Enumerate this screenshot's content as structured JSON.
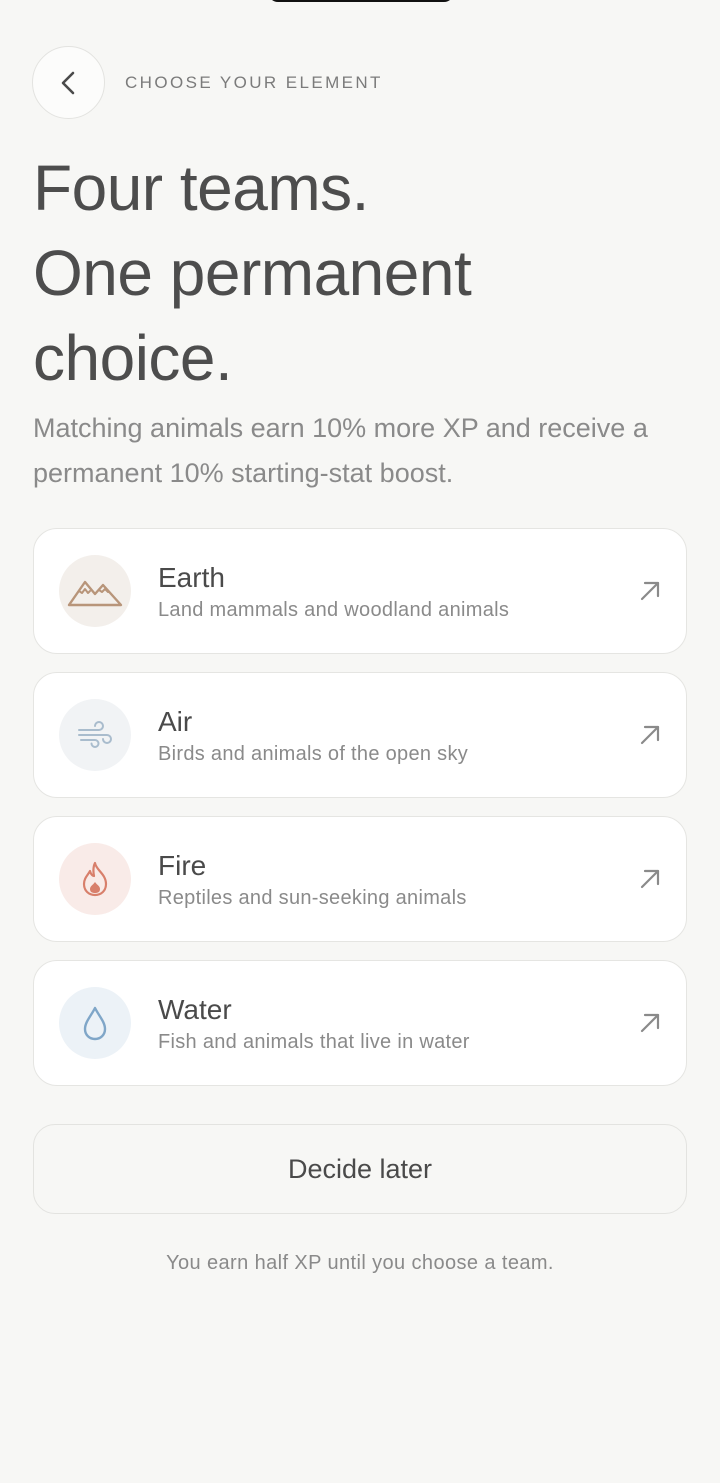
{
  "header": {
    "back_icon": "chevron-left-icon",
    "eyebrow": "CHOOSE YOUR ELEMENT"
  },
  "title": {
    "line1": "Four teams.",
    "line2": "One permanent",
    "line3": "choice."
  },
  "subtitle": "Matching animals earn 10% more XP and receive a permanent 10% starting-stat boost.",
  "teams": [
    {
      "name": "Earth",
      "description": "Land mammals and woodland animals",
      "icon": "mountain-icon",
      "icon_bg": "#f3efeb",
      "icon_color": "#b8957a"
    },
    {
      "name": "Air",
      "description": "Birds and animals of the open sky",
      "icon": "wind-icon",
      "icon_bg": "#f1f3f5",
      "icon_color": "#a9bccd"
    },
    {
      "name": "Fire",
      "description": "Reptiles and sun-seeking animals",
      "icon": "flame-icon",
      "icon_bg": "#f9ebe8",
      "icon_color": "#d87f6b"
    },
    {
      "name": "Water",
      "description": "Fish and animals that live in water",
      "icon": "droplet-icon",
      "icon_bg": "#ecf2f7",
      "icon_color": "#7fa6c8"
    }
  ],
  "arrow_icon": "arrow-up-right-icon",
  "decide_later": "Decide later",
  "footnote": "You earn half XP until you choose a team."
}
